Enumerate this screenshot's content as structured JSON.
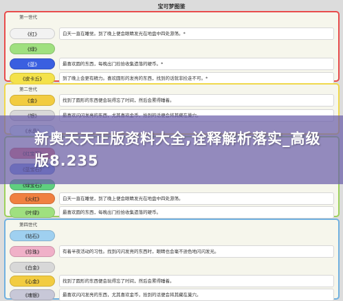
{
  "title": "宝可梦图鉴",
  "sections": [
    {
      "label": "第一世代",
      "border": "#e84a4a",
      "rows": [
        {
          "name": "《红》",
          "color": "#f2f2f2",
          "text": "白天一直在睡觉。到了晚上便会眼睛发光在地盘中四处游荡。*"
        },
        {
          "name": "《绿》",
          "color": "#9fe07f",
          "text": ""
        },
        {
          "name": "《蓝》",
          "color": "#3a5fe0",
          "text": "最喜欢圆的东西，每晚出门捡拾收集遗落的硬币。*"
        },
        {
          "name": "《皮卡丘》",
          "color": "#f4e24a",
          "text": "到了晚上会更有精力。喜欢圆形的发亮的东西，找到的话就非捡走不可。*"
        }
      ]
    },
    {
      "label": "第二世代",
      "border": "#f0d84a",
      "rows": [
        {
          "name": "《金》",
          "color": "#f2cc40",
          "text": "找到了圆形的东西便会玩得忘了时间，然后会累得睡着。"
        },
        {
          "name": "《银》",
          "color": "#d8d8d8",
          "text": "最喜欢闪闪发亮的东西，尤其喜欢金币，拾到的话便会将其藏在巢穴。"
        },
        {
          "name": "《水晶》",
          "color": "#cfe8f0",
          "text": ""
        }
      ]
    },
    {
      "label": "",
      "border": "#9cd05a",
      "rows": [
        {
          "name": "《红宝石》",
          "color": "#e87070",
          "text": ""
        },
        {
          "name": "《蓝宝石》",
          "color": "#6f8fe0",
          "text": ""
        },
        {
          "name": "《绿宝石》",
          "color": "#5fcf7f",
          "text": ""
        },
        {
          "name": "《火红》",
          "color": "#f08040",
          "text": "白天一直在睡觉，到了晚上便会眼睛发光在地盘中四处游荡。"
        },
        {
          "name": "《叶绿》",
          "color": "#9fe07f",
          "text": "最喜欢圆的东西，每晚出门捡拾收集遗落的硬币。"
        }
      ]
    },
    {
      "label": "第四世代",
      "border": "#6fb0e0",
      "rows": [
        {
          "name": "《钻石》",
          "color": "#9fd0f0",
          "text": ""
        },
        {
          "name": "《珍珠》",
          "color": "#f0b0c8",
          "text": "有着半夜活动的习性。找到闪闪发亮的东西时，眼睛也会毫不逊色地闪闪发光。"
        },
        {
          "name": "《白金》",
          "color": "#d8d8d8",
          "text": ""
        },
        {
          "name": "《心金》",
          "color": "#f2cc40",
          "text": "找到了圆形的东西便会玩得忘了时间，然后会累得睡着。"
        },
        {
          "name": "《魂银》",
          "color": "#c8c8d8",
          "text": "最喜欢闪闪发亮的东西，尤其喜欢金币，拾到的话便会将其藏在巢穴。"
        }
      ]
    }
  ],
  "banner": {
    "text": "新奥天天正版资料大全,诠释解析落实_高级版8.235"
  }
}
